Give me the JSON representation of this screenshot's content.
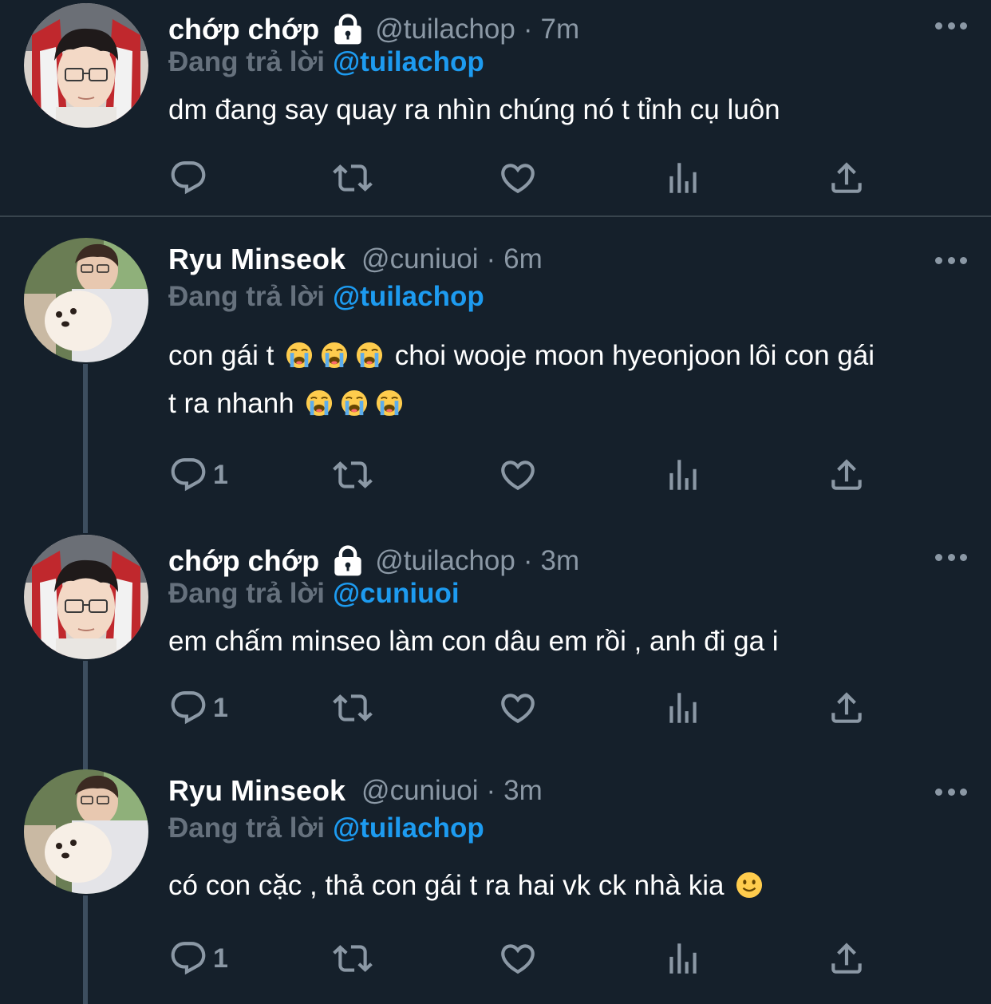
{
  "tweets": [
    {
      "name": "chớp chớp",
      "handle": "@tuilachop",
      "time": "7m",
      "locked": true,
      "reply_label": "Đang trả lời",
      "reply_to": "@tuilachop",
      "text": "dm đang say quay ra nhìn chúng nó t tỉnh cụ luôn",
      "reply_count": ""
    },
    {
      "name": "Ryu Minseok",
      "handle": "@cuniuoi",
      "time": "6m",
      "locked": false,
      "reply_label": "Đang trả lời",
      "reply_to": "@tuilachop",
      "text_line1": "con gái t",
      "text_line1b": "choi wooje moon hyeonjoon lôi con gái",
      "text_line2": "t ra nhanh",
      "reply_count": "1"
    },
    {
      "name": "chớp chớp",
      "handle": "@tuilachop",
      "time": "3m",
      "locked": true,
      "reply_label": "Đang trả lời",
      "reply_to": "@cuniuoi",
      "text": "em chấm minseo làm con dâu em rồi , anh đi ga i",
      "reply_count": "1"
    },
    {
      "name": "Ryu Minseok",
      "handle": "@cuniuoi",
      "time": "3m",
      "locked": false,
      "reply_label": "Đang trả lời",
      "reply_to": "@tuilachop",
      "text": "có con cặc , thả con gái t ra hai vk ck nhà kia",
      "reply_count": "1"
    }
  ],
  "separator": "·",
  "icons": {
    "reply": "reply-icon",
    "retweet": "retweet-icon",
    "like": "heart-icon",
    "views": "views-icon",
    "share": "share-icon",
    "more": "more-icon",
    "lock": "lock-icon",
    "emoji_cry": "loudly-crying-face-emoji",
    "emoji_smile": "slightly-smiling-face-emoji"
  },
  "colors": {
    "background": "#15202b",
    "accent": "#1d9bf0",
    "muted": "#8b98a5",
    "divider": "#38444d"
  }
}
